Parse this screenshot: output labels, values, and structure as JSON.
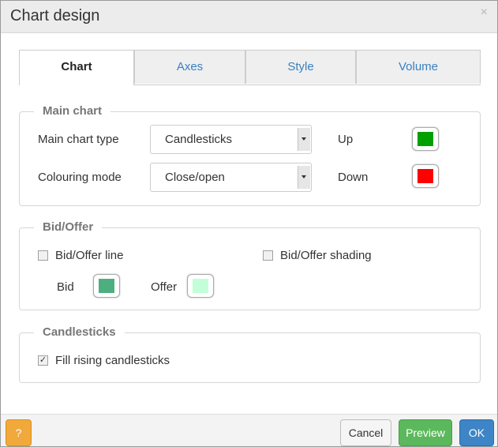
{
  "dialog": {
    "title": "Chart design",
    "close_icon": "×"
  },
  "tabs": [
    {
      "label": "Chart",
      "active": true
    },
    {
      "label": "Axes",
      "active": false
    },
    {
      "label": "Style",
      "active": false
    },
    {
      "label": "Volume",
      "active": false
    }
  ],
  "main_chart": {
    "legend": "Main chart",
    "chart_type_label": "Main chart type",
    "chart_type_value": "Candlesticks",
    "colouring_mode_label": "Colouring mode",
    "colouring_mode_value": "Close/open",
    "up_label": "Up",
    "up_color": "#00a000",
    "down_label": "Down",
    "down_color": "#ff0000"
  },
  "bid_offer": {
    "legend": "Bid/Offer",
    "line_label": "Bid/Offer line",
    "line_checked": false,
    "shading_label": "Bid/Offer shading",
    "shading_checked": false,
    "bid_label": "Bid",
    "bid_color": "#4daf80",
    "offer_label": "Offer",
    "offer_color": "#c2ffd9"
  },
  "candlesticks": {
    "legend": "Candlesticks",
    "fill_rising_label": "Fill rising candlesticks",
    "fill_rising_checked": true,
    "check_mark": "✓"
  },
  "footer": {
    "help_label": "?",
    "cancel_label": "Cancel",
    "preview_label": "Preview",
    "ok_label": "OK"
  }
}
